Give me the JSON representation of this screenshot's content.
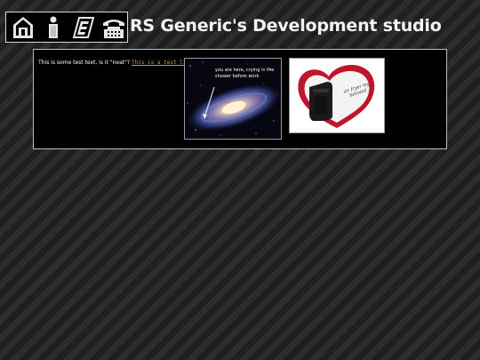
{
  "header": {
    "title": "RS Generic's Development studio"
  },
  "nav": {
    "items": [
      {
        "name": "home-icon"
      },
      {
        "name": "info-icon"
      },
      {
        "name": "edit-icon"
      },
      {
        "name": "phone-icon"
      }
    ]
  },
  "panel": {
    "text": "This is some test text, is it \"neat\"?",
    "link_text": "This is a test link!",
    "galaxy_caption": "you are here, crying in the shower before work",
    "heart_caption": "air fryer my beloved"
  },
  "colors": {
    "background": "#262626",
    "panel_background": "#000000",
    "link": "#c89a4a",
    "heart_red": "#c0142a"
  }
}
